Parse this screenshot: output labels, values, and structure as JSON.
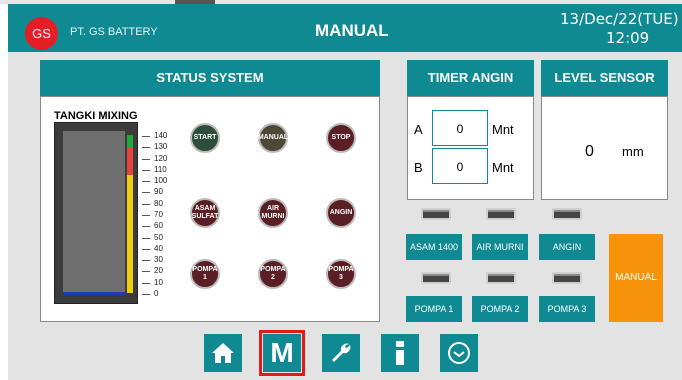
{
  "header": {
    "logo": "GS",
    "company": "PT. GS BATTERY",
    "title": "MANUAL",
    "date": "13/Dec/22(TUE)",
    "time": "12:09"
  },
  "status": {
    "title": "STATUS SYSTEM",
    "tank_title": "TANGKI MIXING",
    "tank_level_percent": 0,
    "scale": [
      "140",
      "130",
      "120",
      "110",
      "100",
      "90",
      "80",
      "70",
      "60",
      "50",
      "40",
      "30",
      "20",
      "10",
      "0"
    ],
    "buttons": [
      {
        "label": "START"
      },
      {
        "label": "MANUAL"
      },
      {
        "label": "STOP"
      },
      {
        "label": "ASAM\nSULFAT"
      },
      {
        "label": "AIR\nMURNI"
      },
      {
        "label": "ANGIN"
      },
      {
        "label": "POMPA\n1"
      },
      {
        "label": "POMPA\n2"
      },
      {
        "label": "POMPA\n3"
      }
    ]
  },
  "timer": {
    "title": "TIMER ANGIN",
    "a_label": "A",
    "a_value": "0",
    "a_unit": "Mnt",
    "b_label": "B",
    "b_value": "0",
    "b_unit": "Mnt"
  },
  "level": {
    "title": "LEVEL SENSOR",
    "value": "0",
    "unit": "mm"
  },
  "manual_controls": {
    "labels": [
      "ASAM 1400",
      "AIR MURNI",
      "ANGIN",
      "POMPA 1",
      "POMPA 2",
      "POMPA 3"
    ],
    "mode_button": "MANUAL"
  },
  "nav": {
    "manual_letter": "M",
    "active": "manual",
    "icons": [
      "home-icon",
      "manual-icon",
      "wrench-icon",
      "info-icon",
      "clock-icon"
    ]
  },
  "colors": {
    "teal": "#0f8a93",
    "orange": "#f7930a",
    "active_border": "#e21a1a",
    "logo_red": "#e31e24"
  }
}
